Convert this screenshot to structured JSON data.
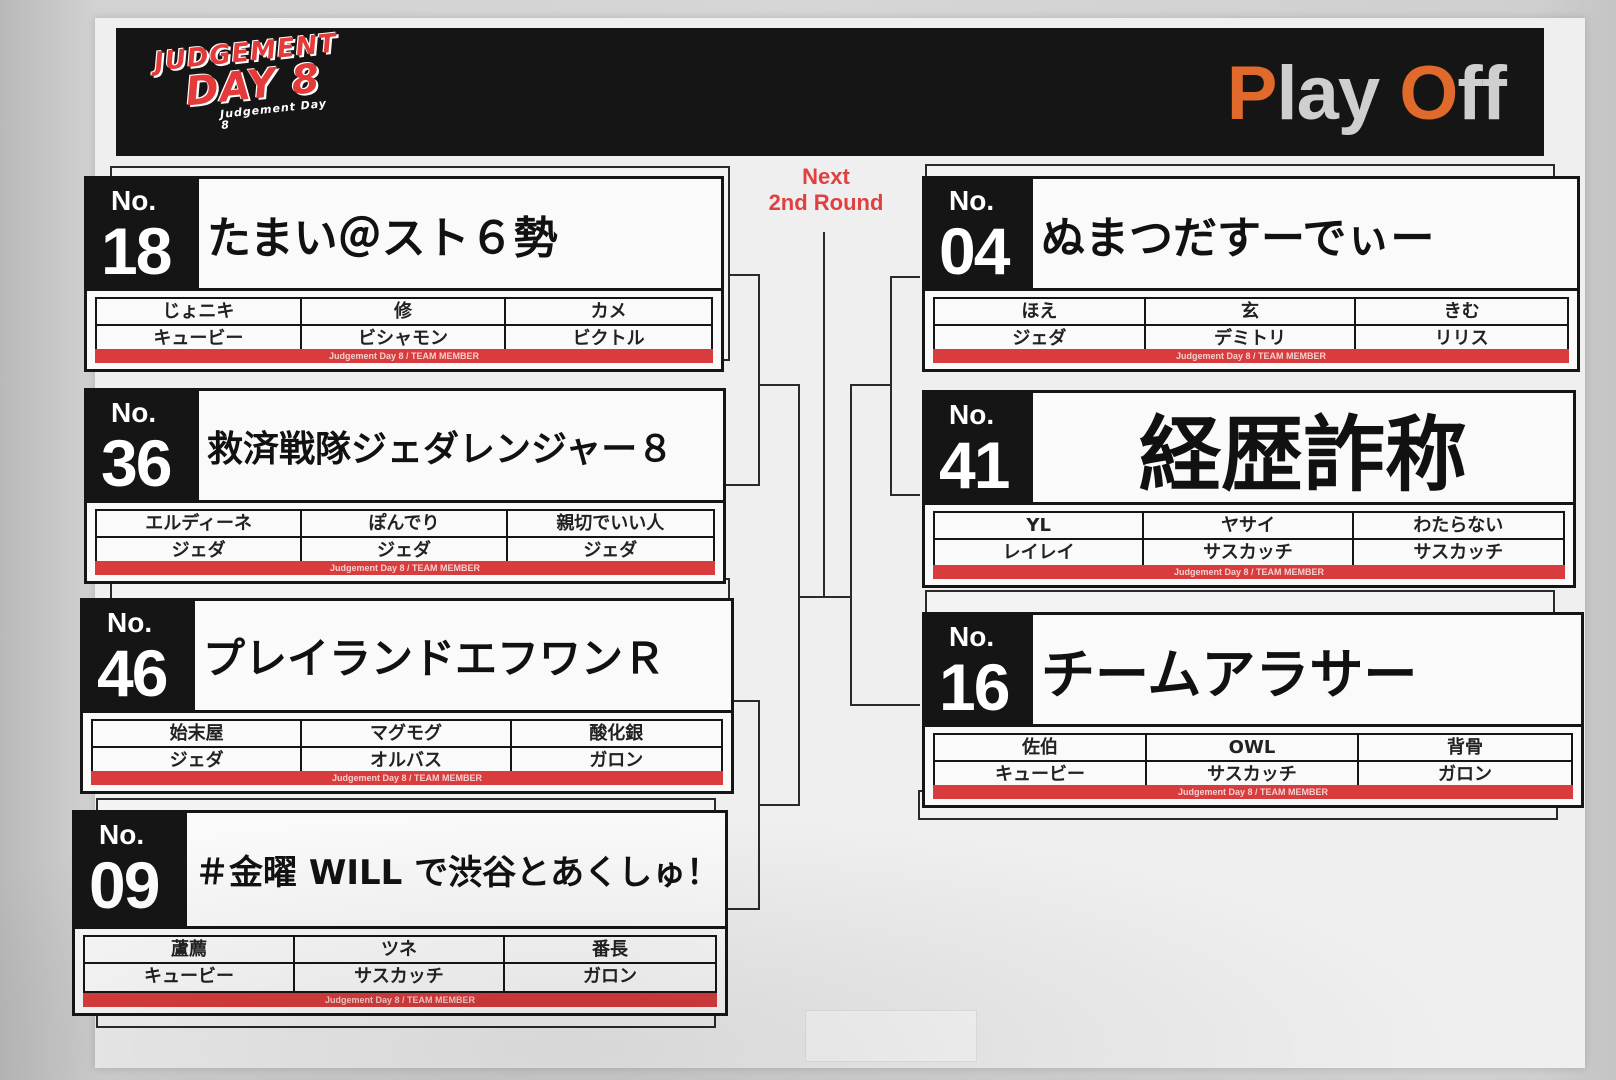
{
  "header": {
    "logo_line1": "JUDGEMENT",
    "logo_line2": "DAY 8",
    "logo_line3": "Judgement Day 8",
    "playoff_first_letter": "P",
    "playoff_mid": "lay ",
    "playoff_o": "O",
    "playoff_end": "ff"
  },
  "next_round": {
    "line1": "Next",
    "line2": "2nd Round"
  },
  "footer_text": "Judgement Day 8 / TEAM MEMBER",
  "no_label": "No.",
  "teams": [
    {
      "number": "18",
      "name": "たまい＠スト６勢",
      "members": [
        "じょニキ",
        "修",
        "カメ",
        "キュービー",
        "ビシャモン",
        "ビクトル"
      ]
    },
    {
      "number": "36",
      "name": "救済戦隊ジェダレンジャー８",
      "members": [
        "エルディーネ",
        "ぽんでり",
        "親切でいい人",
        "ジェダ",
        "ジェダ",
        "ジェダ"
      ]
    },
    {
      "number": "46",
      "name": "プレイランドエフワンＲ",
      "members": [
        "始末屋",
        "マグモグ",
        "酸化銀",
        "ジェダ",
        "オルバス",
        "ガロン"
      ]
    },
    {
      "number": "09",
      "name": "＃金曜 WILL で渋谷とあくしゅ！",
      "members": [
        "蘆薦",
        "ツネ",
        "番長",
        "キュービー",
        "サスカッチ",
        "ガロン"
      ]
    },
    {
      "number": "04",
      "name": "ぬまつだすーでぃー",
      "members": [
        "ほえ",
        "玄",
        "きむ",
        "ジェダ",
        "デミトリ",
        "リリス"
      ]
    },
    {
      "number": "41",
      "name": "経歴詐称",
      "members": [
        "YL",
        "ヤサイ",
        "わたらない",
        "レイレイ",
        "サスカッチ",
        "サスカッチ"
      ]
    },
    {
      "number": "16",
      "name": "チームアラサー",
      "members": [
        "佐伯",
        "OWL",
        "背骨",
        "キュービー",
        "サスカッチ",
        "ガロン"
      ]
    }
  ]
}
